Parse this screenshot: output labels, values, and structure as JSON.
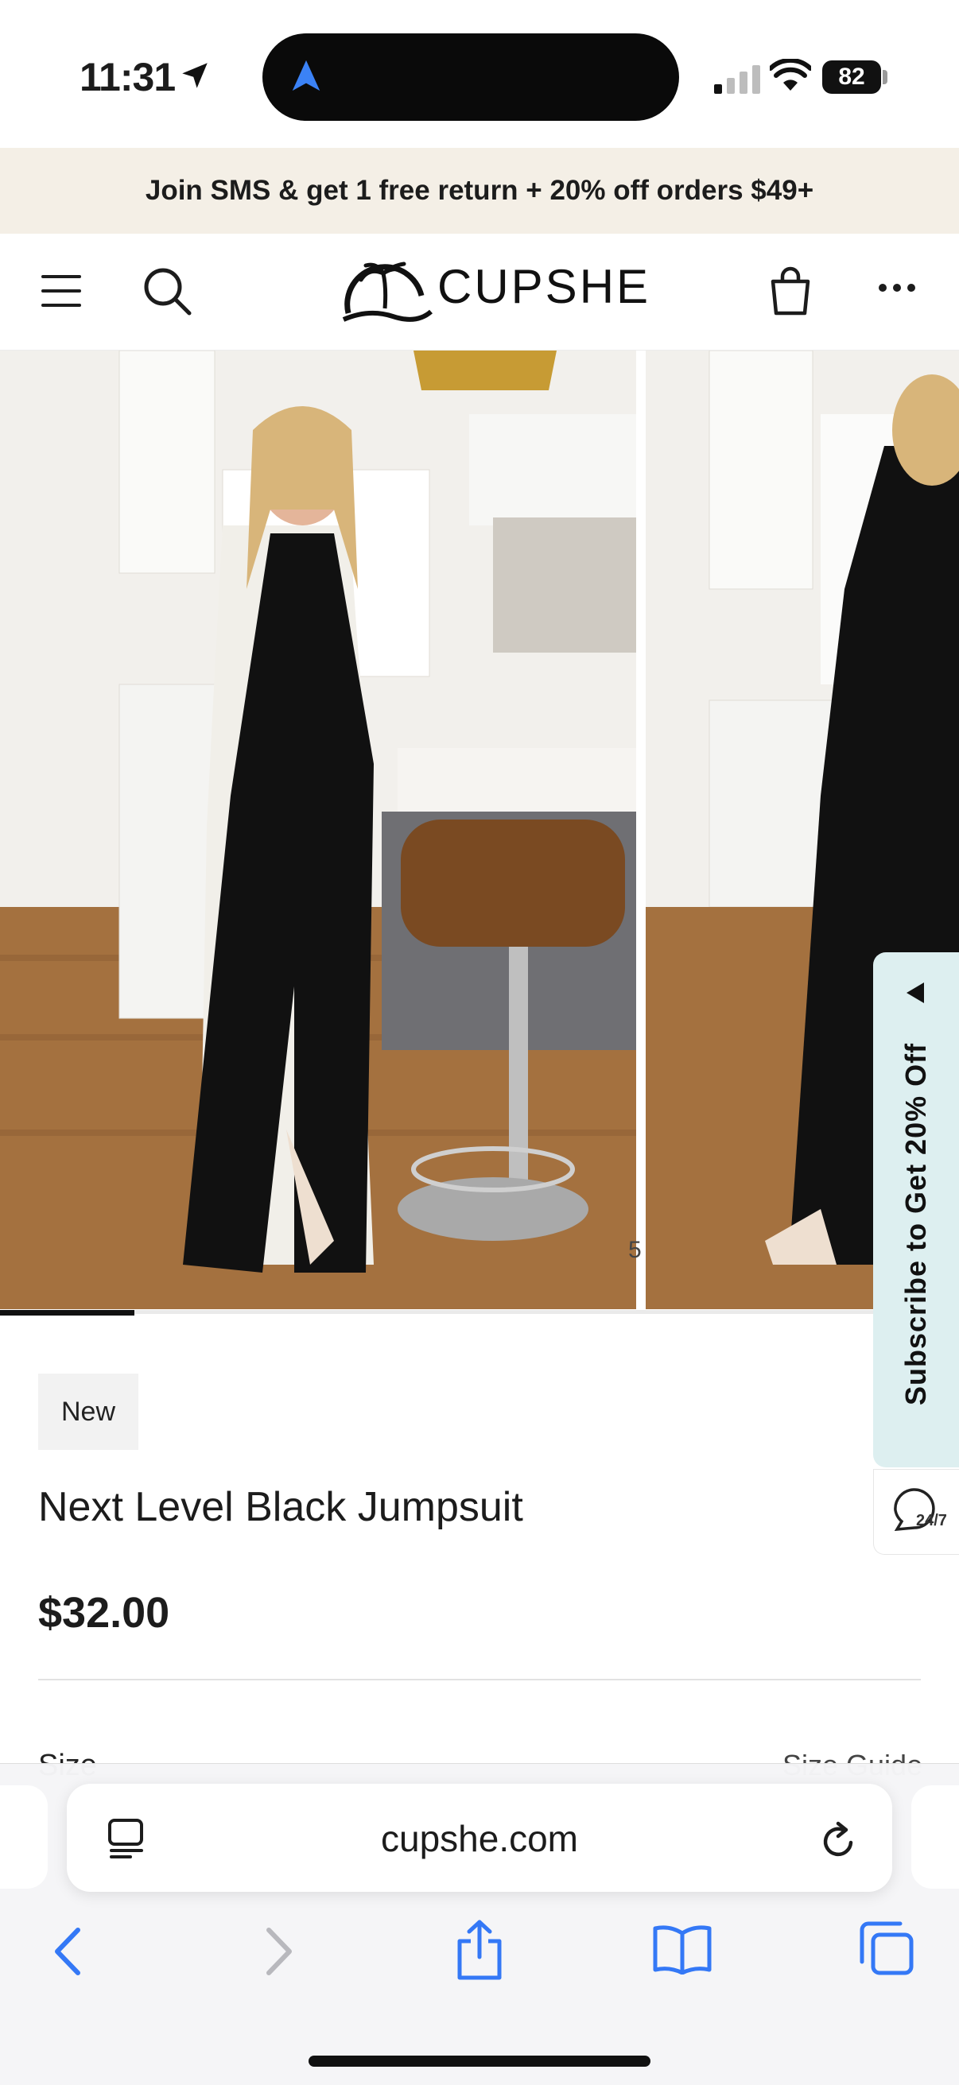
{
  "status_bar": {
    "time": "11:31",
    "battery": "82"
  },
  "promo_banner": {
    "text": "Join SMS & get 1 free return + 20% off orders $49+"
  },
  "header": {
    "brand": "CUPSHE"
  },
  "gallery": {
    "current_index": 1,
    "progress_fraction": 0.14,
    "partial_index_glyph": "5"
  },
  "product": {
    "badge": "New",
    "title": "Next Level Black Jumpsuit",
    "price": "$32.00",
    "size_label": "Size",
    "size_guide_label": "Size Guide"
  },
  "side_tabs": {
    "subscribe": "Subscribe to Get 20% Off",
    "support": "24/7"
  },
  "browser": {
    "url": "cupshe.com"
  },
  "icons": {
    "header_left": [
      "menu-icon",
      "search-icon"
    ],
    "header_right": [
      "shopping-bag-icon",
      "more-icon"
    ],
    "browser_toolbar": [
      "back-icon",
      "forward-icon",
      "share-icon",
      "bookmarks-icon",
      "tabs-icon"
    ]
  },
  "colors": {
    "promo_bg": "#f4efe6",
    "subscribe_bg": "#ddeff0",
    "browser_accent": "#3478f6",
    "location_arrow": "#3b82f6"
  }
}
